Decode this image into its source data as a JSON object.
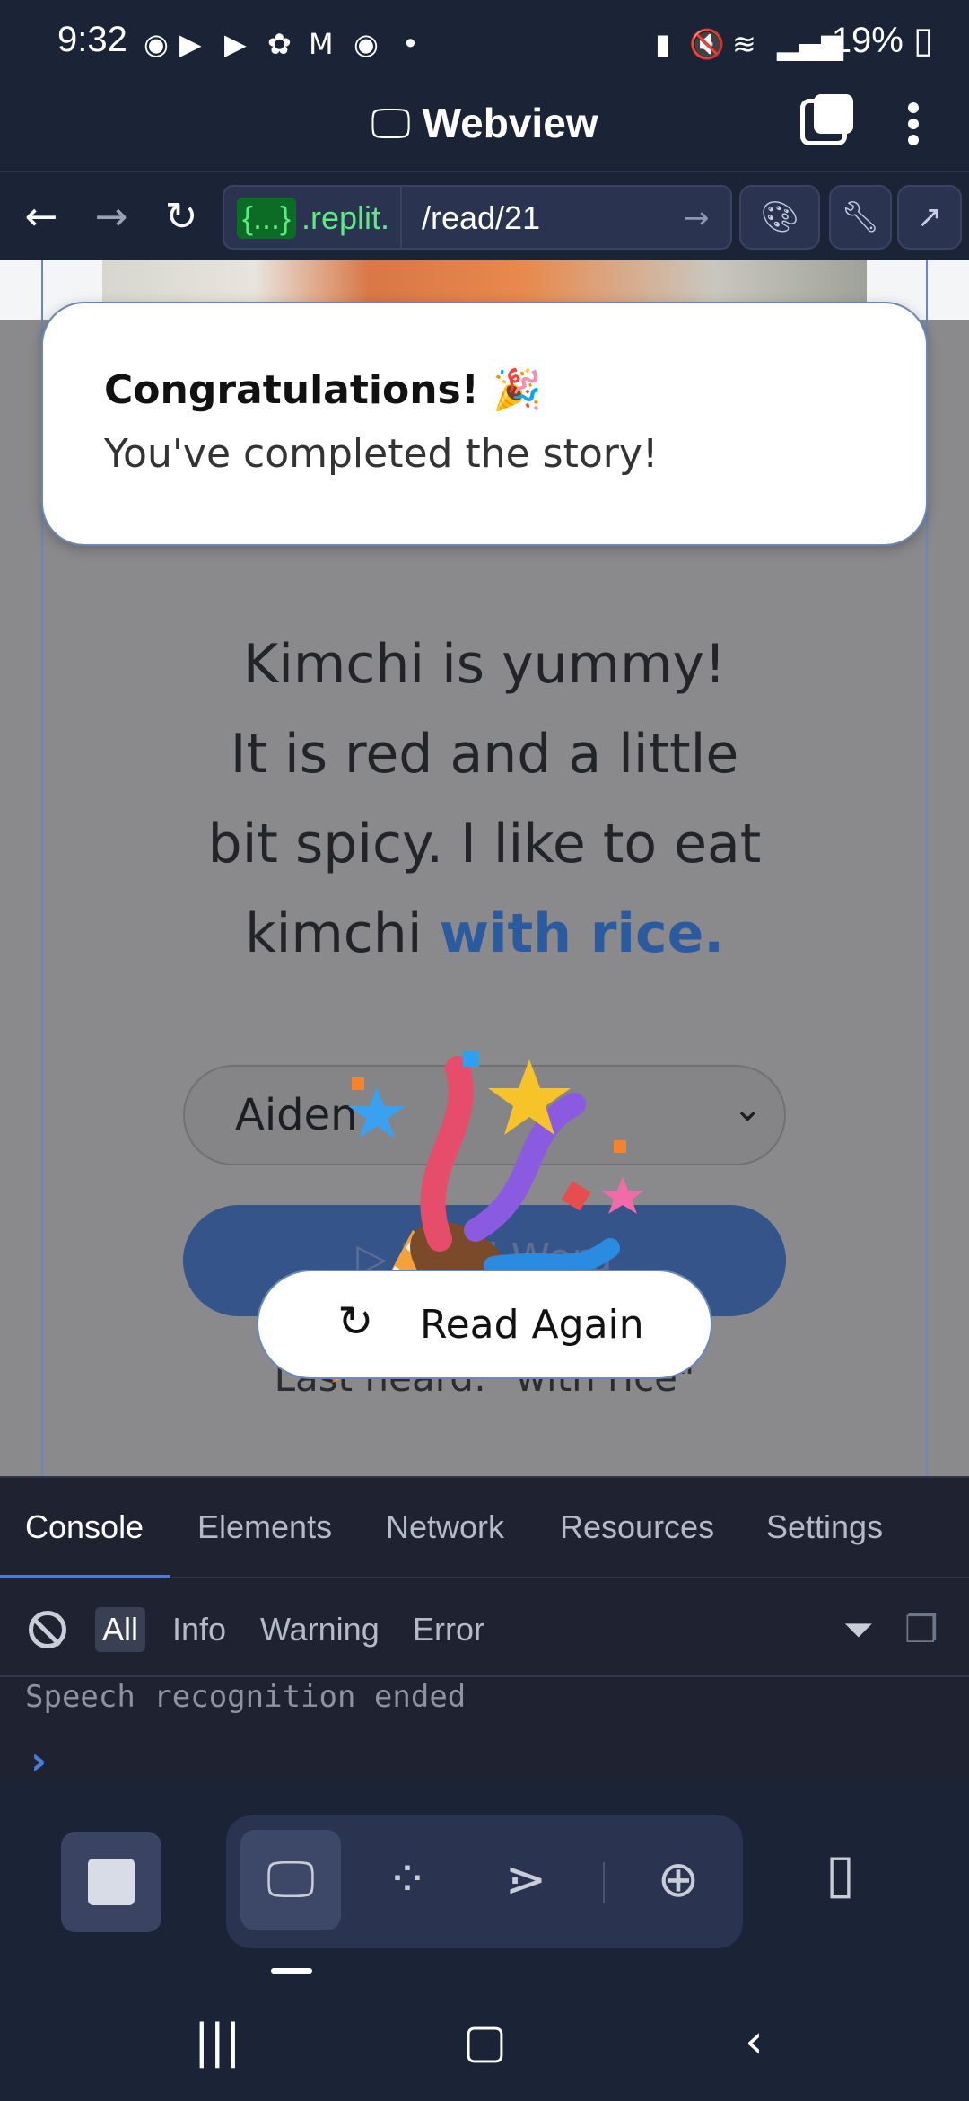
{
  "status_bar": {
    "time": "9:32",
    "notification_icons": [
      "chrome-icon",
      "youtube-icon",
      "youtube-icon",
      "settings-flower-icon",
      "gmail-icon",
      "chrome-icon",
      "dot-icon"
    ],
    "battery_percent": "19%"
  },
  "app_header": {
    "title": "Webview"
  },
  "url_bar": {
    "host_chip": "{...}",
    "host_rest": ".replit.",
    "path": "/read/21"
  },
  "toast": {
    "title": "Congratulations! 🎉",
    "body": "You've completed the story!"
  },
  "story": {
    "line1": "Kimchi is yummy!",
    "line2": "It is red and a little",
    "line3": "bit spicy. I like to eat",
    "line4_plain": "kimchi ",
    "line4_highlight": "with rice."
  },
  "voice_select": {
    "value": "Aiden"
  },
  "read_word_button": {
    "label": "Read Word"
  },
  "read_again_button": {
    "label": "Read Again"
  },
  "last_heard": "Last heard: \"with rice\"",
  "devtools": {
    "tabs": [
      "Console",
      "Elements",
      "Network",
      "Resources",
      "Settings"
    ],
    "active_tab": "Console",
    "filters": [
      "All",
      "Info",
      "Warning",
      "Error"
    ],
    "active_filter": "All",
    "log_line": "Speech recognition ended"
  },
  "colors": {
    "dark_bg": "#1b2337",
    "accent_blue": "#4b7cd8",
    "highlight_text": "#2c5a9e",
    "read_word_bg": "#35548a"
  }
}
